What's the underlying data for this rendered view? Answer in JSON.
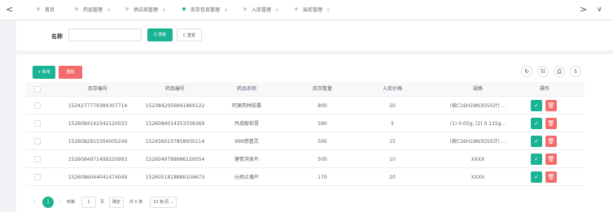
{
  "tabs_bar": {
    "prev_glyph": "<",
    "next_glyph": ">",
    "dropdown_glyph": "∨",
    "tabs": [
      {
        "label": "首页"
      },
      {
        "label": "药品管理"
      },
      {
        "label": "供应商管理"
      },
      {
        "label": "库存信息管理"
      },
      {
        "label": "入库管理"
      },
      {
        "label": "出库管理"
      }
    ],
    "close_glyph": "×",
    "active_color": "#1ab394"
  },
  "search": {
    "name_label": "名称",
    "name_value": "",
    "search_button": "Q 搜索",
    "reset_button": "C 重置"
  },
  "toolbar": {
    "add_button": "+ 新增",
    "delete_button": "删除",
    "refresh_icon": "refresh-icon",
    "columns_icon": "columns-icon",
    "print_icon": "print-icon",
    "export_icon": "export-icon"
  },
  "table": {
    "headers": [
      "库存编号",
      "药品编号",
      "药品名称",
      "库存数量",
      "入库价格",
      "规格",
      "操作"
    ],
    "rows": [
      {
        "stock_id": "1524277779384307714",
        "drug_id": "1523842056941869122",
        "name": "阿莫西林胶囊",
        "qty": "800",
        "price": "20",
        "spec": "(按C16H19N3O5S计) ..."
      },
      {
        "stock_id": "1526084142342120033",
        "drug_id": "1526084014353338369",
        "name": "丹皮酚软膏",
        "qty": "590",
        "price": "5",
        "spec": "(1) 0.05g, (2) 0.125g..."
      },
      {
        "stock_id": "1526082915304005249",
        "drug_id": "1524560237858930114",
        "name": "999感冒灵",
        "qty": "500",
        "price": "15",
        "spec": "(按C16H19N3O5S计) ..."
      },
      {
        "stock_id": "1526084971499220993",
        "drug_id": "1526049788986159554",
        "name": "健胃消食片",
        "qty": "500",
        "price": "10",
        "spec": "XXXX"
      },
      {
        "stock_id": "1526086044041474049",
        "drug_id": "1526051818886109673",
        "name": "元胡止痛片",
        "qty": "170",
        "price": "20",
        "spec": "XXXX"
      }
    ],
    "edit_icon": "edit-icon",
    "delete_icon": "trash-icon"
  },
  "pagination": {
    "prev_glyph": "<",
    "current_page": "1",
    "next_glyph": ">",
    "goto_label": "到第",
    "goto_value": "1",
    "page_unit": "页",
    "confirm_button": "确定",
    "total_text": "共 5 条",
    "page_size": "10 条/页"
  }
}
